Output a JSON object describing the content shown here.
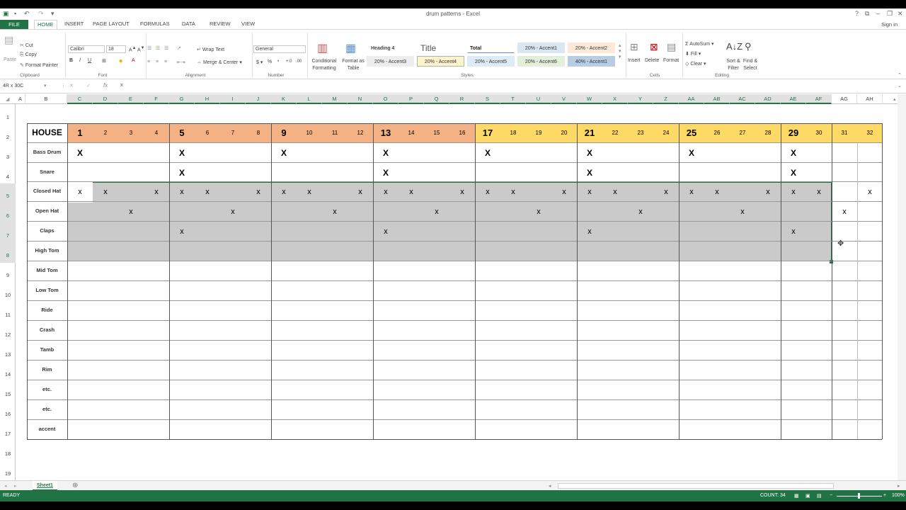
{
  "window": {
    "title": "drum patterns - Excel",
    "sign_in": "Sign in"
  },
  "ribbon_tabs": [
    "FILE",
    "HOME",
    "INSERT",
    "PAGE LAYOUT",
    "FORMULAS",
    "DATA",
    "REVIEW",
    "VIEW"
  ],
  "ribbon": {
    "clipboard": {
      "paste": "Paste",
      "cut": "Cut",
      "copy": "Copy",
      "format_painter": "Format Painter",
      "label": "Clipboard"
    },
    "font": {
      "name": "Calibri",
      "size": "18",
      "label": "Font"
    },
    "alignment": {
      "wrap": "Wrap Text",
      "merge": "Merge & Center",
      "label": "Alignment"
    },
    "number": {
      "format": "General",
      "label": "Number"
    },
    "styles": {
      "conditional": "Conditional Formatting",
      "format_table": "Format as Table",
      "cells": [
        {
          "text": "Heading 4",
          "bg": "#ffffff",
          "color": "#444444"
        },
        {
          "text": "Title",
          "bg": "#ffffff",
          "color": "#555555"
        },
        {
          "text": "Total",
          "bg": "#ffffff",
          "color": "#222222"
        },
        {
          "text": "20% - Accent1",
          "bg": "#dce6f1",
          "color": "#333333"
        },
        {
          "text": "20% - Accent2",
          "bg": "#fde9d9",
          "color": "#333333"
        },
        {
          "text": "20% - Accent3",
          "bg": "#ededed",
          "color": "#333333"
        },
        {
          "text": "20% - Accent4",
          "bg": "#fff2cc",
          "color": "#333333"
        },
        {
          "text": "20% - Accent5",
          "bg": "#ddebf7",
          "color": "#333333"
        },
        {
          "text": "20% - Accent6",
          "bg": "#e2efda",
          "color": "#333333"
        },
        {
          "text": "40% - Accent1",
          "bg": "#b8cce4",
          "color": "#333333"
        }
      ],
      "label": "Styles"
    },
    "cells": {
      "insert": "Insert",
      "delete": "Delete",
      "format": "Format",
      "label": "Cells"
    },
    "editing": {
      "autosum": "AutoSum",
      "fill": "Fill",
      "clear": "Clear",
      "sort": "Sort & Filter",
      "find": "Find & Select",
      "label": "Editing"
    }
  },
  "formula_bar": {
    "name_box": "4R x 30C",
    "value": "x"
  },
  "columns": [
    "A",
    "B",
    "C",
    "D",
    "E",
    "F",
    "G",
    "H",
    "I",
    "J",
    "K",
    "L",
    "M",
    "N",
    "O",
    "P",
    "Q",
    "R",
    "S",
    "T",
    "U",
    "V",
    "W",
    "X",
    "Y",
    "Z",
    "AA",
    "AB",
    "AC",
    "AD",
    "AE",
    "AF",
    "AG",
    "AH"
  ],
  "rows": [
    "1",
    "2",
    "3",
    "4",
    "5",
    "6",
    "7",
    "8",
    "9",
    "10",
    "11",
    "12",
    "13",
    "14",
    "15",
    "16",
    "17",
    "18",
    "19"
  ],
  "grid": {
    "house_label": "HOUSE",
    "steps": [
      "1",
      "2",
      "3",
      "4",
      "5",
      "6",
      "7",
      "8",
      "9",
      "10",
      "11",
      "12",
      "13",
      "14",
      "15",
      "16",
      "17",
      "18",
      "19",
      "20",
      "21",
      "22",
      "23",
      "24",
      "25",
      "26",
      "27",
      "28",
      "29",
      "30",
      "31",
      "32"
    ],
    "step_colors": {
      "salmon": "#f4b183",
      "yellow": "#ffd966"
    },
    "mark_symbol": "X",
    "mark_symbol_lower": "x",
    "instruments": [
      {
        "name": "Bass Drum",
        "hits": [
          1,
          5,
          9,
          13,
          17,
          21,
          25,
          29
        ],
        "case": "upper"
      },
      {
        "name": "Snare",
        "hits": [
          5,
          13,
          21,
          29
        ],
        "case": "upper"
      },
      {
        "name": "Closed Hat",
        "hits": [
          1,
          2,
          4,
          5,
          6,
          8,
          9,
          10,
          12,
          13,
          14,
          16,
          17,
          18,
          20,
          21,
          22,
          24,
          25,
          26,
          28,
          29,
          30,
          32
        ],
        "case": "lower"
      },
      {
        "name": "Open Hat",
        "hits": [
          3,
          7,
          11,
          15,
          19,
          23,
          27,
          31
        ],
        "case": "lower"
      },
      {
        "name": "Claps",
        "hits": [
          5,
          13,
          21,
          29
        ],
        "case": "lower"
      },
      {
        "name": "High Tom",
        "hits": [],
        "case": "lower"
      },
      {
        "name": "Mid Tom",
        "hits": [],
        "case": "lower"
      },
      {
        "name": "Low Tom",
        "hits": [],
        "case": "lower"
      },
      {
        "name": "Ride",
        "hits": [],
        "case": "lower"
      },
      {
        "name": "Crash",
        "hits": [],
        "case": "lower"
      },
      {
        "name": "Tamb",
        "hits": [],
        "case": "lower"
      },
      {
        "name": "Rim",
        "hits": [],
        "case": "lower"
      },
      {
        "name": "etc.",
        "hits": [],
        "case": "lower"
      },
      {
        "name": "etc.",
        "hits": [],
        "case": "lower"
      },
      {
        "name": "accent",
        "hits": [],
        "case": "lower"
      }
    ]
  },
  "sheet_tabs": [
    "Sheet1"
  ],
  "status": {
    "ready": "READY",
    "count": "COUNT: 34",
    "zoom": "100%"
  }
}
